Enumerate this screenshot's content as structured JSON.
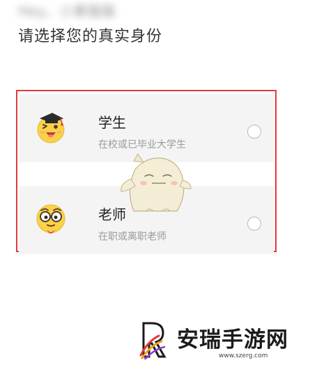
{
  "header": {
    "blurred_greeting": "Hey，小果猫猫",
    "title": "请选择您的真实身份"
  },
  "roles": [
    {
      "title": "学生",
      "description": "在校或已毕业大学生",
      "avatar_icon": "student-graduation-cap-emoji-icon",
      "selected": false
    },
    {
      "title": "老师",
      "description": "在职或离职老师",
      "avatar_icon": "teacher-glasses-emoji-icon",
      "selected": false
    }
  ],
  "watermark": {
    "name": "安瑞手游网",
    "url": "www.szerg.com"
  },
  "colors": {
    "highlight_border": "#e0393e",
    "card_background": "#f4f4f4",
    "emoji_yellow": "#f9d24a",
    "radio_border": "#b8b8b8"
  }
}
